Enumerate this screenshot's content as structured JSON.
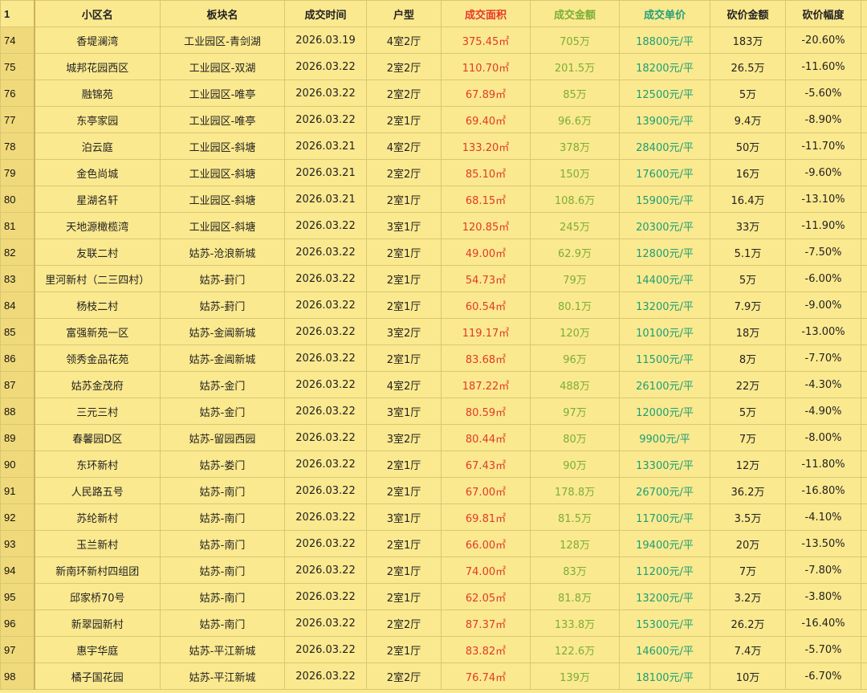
{
  "header_row_number": "1",
  "columns": [
    "小区名",
    "板块名",
    "成交时间",
    "户型",
    "成交面积",
    "成交金额",
    "成交单价",
    "砍价金额",
    "砍价幅度"
  ],
  "rows": [
    {
      "n": "74",
      "name": "香堤澜湾",
      "block": "工业园区-青剑湖",
      "date": "2026.03.19",
      "type": "4室2厅",
      "area": "375.45㎡",
      "total": "705万",
      "unit": "18800元/平",
      "cut": "183万",
      "pct": "-20.60%"
    },
    {
      "n": "75",
      "name": "城邦花园西区",
      "block": "工业园区-双湖",
      "date": "2026.03.22",
      "type": "2室2厅",
      "area": "110.70㎡",
      "total": "201.5万",
      "unit": "18200元/平",
      "cut": "26.5万",
      "pct": "-11.60%"
    },
    {
      "n": "76",
      "name": "融锦苑",
      "block": "工业园区-唯亭",
      "date": "2026.03.22",
      "type": "2室2厅",
      "area": "67.89㎡",
      "total": "85万",
      "unit": "12500元/平",
      "cut": "5万",
      "pct": "-5.60%"
    },
    {
      "n": "77",
      "name": "东亭家园",
      "block": "工业园区-唯亭",
      "date": "2026.03.22",
      "type": "2室1厅",
      "area": "69.40㎡",
      "total": "96.6万",
      "unit": "13900元/平",
      "cut": "9.4万",
      "pct": "-8.90%"
    },
    {
      "n": "78",
      "name": "泊云庭",
      "block": "工业园区-斜塘",
      "date": "2026.03.21",
      "type": "4室2厅",
      "area": "133.20㎡",
      "total": "378万",
      "unit": "28400元/平",
      "cut": "50万",
      "pct": "-11.70%"
    },
    {
      "n": "79",
      "name": "金色尚城",
      "block": "工业园区-斜塘",
      "date": "2026.03.21",
      "type": "2室2厅",
      "area": "85.10㎡",
      "total": "150万",
      "unit": "17600元/平",
      "cut": "16万",
      "pct": "-9.60%"
    },
    {
      "n": "80",
      "name": "星湖名轩",
      "block": "工业园区-斜塘",
      "date": "2026.03.21",
      "type": "2室1厅",
      "area": "68.15㎡",
      "total": "108.6万",
      "unit": "15900元/平",
      "cut": "16.4万",
      "pct": "-13.10%"
    },
    {
      "n": "81",
      "name": "天地源橄榄湾",
      "block": "工业园区-斜塘",
      "date": "2026.03.22",
      "type": "3室1厅",
      "area": "120.85㎡",
      "total": "245万",
      "unit": "20300元/平",
      "cut": "33万",
      "pct": "-11.90%"
    },
    {
      "n": "82",
      "name": "友联二村",
      "block": "姑苏-沧浪新城",
      "date": "2026.03.22",
      "type": "2室1厅",
      "area": "49.00㎡",
      "total": "62.9万",
      "unit": "12800元/平",
      "cut": "5.1万",
      "pct": "-7.50%"
    },
    {
      "n": "83",
      "name": "里河新村（二三四村）",
      "block": "姑苏-葑门",
      "date": "2026.03.22",
      "type": "2室1厅",
      "area": "54.73㎡",
      "total": "79万",
      "unit": "14400元/平",
      "cut": "5万",
      "pct": "-6.00%"
    },
    {
      "n": "84",
      "name": "杨枝二村",
      "block": "姑苏-葑门",
      "date": "2026.03.22",
      "type": "2室1厅",
      "area": "60.54㎡",
      "total": "80.1万",
      "unit": "13200元/平",
      "cut": "7.9万",
      "pct": "-9.00%"
    },
    {
      "n": "85",
      "name": "富强新苑一区",
      "block": "姑苏-金阊新城",
      "date": "2026.03.22",
      "type": "3室2厅",
      "area": "119.17㎡",
      "total": "120万",
      "unit": "10100元/平",
      "cut": "18万",
      "pct": "-13.00%"
    },
    {
      "n": "86",
      "name": "领秀金品花苑",
      "block": "姑苏-金阊新城",
      "date": "2026.03.22",
      "type": "2室1厅",
      "area": "83.68㎡",
      "total": "96万",
      "unit": "11500元/平",
      "cut": "8万",
      "pct": "-7.70%"
    },
    {
      "n": "87",
      "name": "姑苏金茂府",
      "block": "姑苏-金门",
      "date": "2026.03.22",
      "type": "4室2厅",
      "area": "187.22㎡",
      "total": "488万",
      "unit": "26100元/平",
      "cut": "22万",
      "pct": "-4.30%"
    },
    {
      "n": "88",
      "name": "三元三村",
      "block": "姑苏-金门",
      "date": "2026.03.22",
      "type": "3室1厅",
      "area": "80.59㎡",
      "total": "97万",
      "unit": "12000元/平",
      "cut": "5万",
      "pct": "-4.90%"
    },
    {
      "n": "89",
      "name": "春馨园D区",
      "block": "姑苏-留园西园",
      "date": "2026.03.22",
      "type": "3室2厅",
      "area": "80.44㎡",
      "total": "80万",
      "unit": "9900元/平",
      "cut": "7万",
      "pct": "-8.00%"
    },
    {
      "n": "90",
      "name": "东环新村",
      "block": "姑苏-娄门",
      "date": "2026.03.22",
      "type": "2室1厅",
      "area": "67.43㎡",
      "total": "90万",
      "unit": "13300元/平",
      "cut": "12万",
      "pct": "-11.80%"
    },
    {
      "n": "91",
      "name": "人民路五号",
      "block": "姑苏-南门",
      "date": "2026.03.22",
      "type": "2室1厅",
      "area": "67.00㎡",
      "total": "178.8万",
      "unit": "26700元/平",
      "cut": "36.2万",
      "pct": "-16.80%"
    },
    {
      "n": "92",
      "name": "苏纶新村",
      "block": "姑苏-南门",
      "date": "2026.03.22",
      "type": "3室1厅",
      "area": "69.81㎡",
      "total": "81.5万",
      "unit": "11700元/平",
      "cut": "3.5万",
      "pct": "-4.10%"
    },
    {
      "n": "93",
      "name": "玉兰新村",
      "block": "姑苏-南门",
      "date": "2026.03.22",
      "type": "2室1厅",
      "area": "66.00㎡",
      "total": "128万",
      "unit": "19400元/平",
      "cut": "20万",
      "pct": "-13.50%"
    },
    {
      "n": "94",
      "name": "新南环新村四组团",
      "block": "姑苏-南门",
      "date": "2026.03.22",
      "type": "2室1厅",
      "area": "74.00㎡",
      "total": "83万",
      "unit": "11200元/平",
      "cut": "7万",
      "pct": "-7.80%"
    },
    {
      "n": "95",
      "name": "邱家桥70号",
      "block": "姑苏-南门",
      "date": "2026.03.22",
      "type": "2室1厅",
      "area": "62.05㎡",
      "total": "81.8万",
      "unit": "13200元/平",
      "cut": "3.2万",
      "pct": "-3.80%"
    },
    {
      "n": "96",
      "name": "新翠园新村",
      "block": "姑苏-南门",
      "date": "2026.03.22",
      "type": "2室2厅",
      "area": "87.37㎡",
      "total": "133.8万",
      "unit": "15300元/平",
      "cut": "26.2万",
      "pct": "-16.40%"
    },
    {
      "n": "97",
      "name": "惠宇华庭",
      "block": "姑苏-平江新城",
      "date": "2026.03.22",
      "type": "2室1厅",
      "area": "83.82㎡",
      "total": "122.6万",
      "unit": "14600元/平",
      "cut": "7.4万",
      "pct": "-5.70%"
    },
    {
      "n": "98",
      "name": "橘子国花园",
      "block": "姑苏-平江新城",
      "date": "2026.03.22",
      "type": "2室2厅",
      "area": "76.74㎡",
      "total": "139万",
      "unit": "18100元/平",
      "cut": "10万",
      "pct": "-6.70%"
    }
  ],
  "colors": {
    "area": "#e03a2a",
    "total": "#7aae35",
    "unit": "#1c9e76",
    "background": "#fbe98f",
    "rownum_bg": "#f0d97a"
  }
}
